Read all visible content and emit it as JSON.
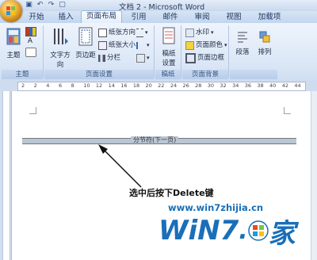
{
  "window": {
    "title": "文档 2 - Microsoft Word"
  },
  "quick_access": [
    {
      "icon": "save-icon",
      "glyph": "▣"
    },
    {
      "icon": "undo-icon",
      "glyph": "↶"
    },
    {
      "icon": "redo-icon",
      "glyph": "↷"
    },
    {
      "icon": "open-icon",
      "glyph": "▢"
    }
  ],
  "tabs": [
    {
      "label": "开始",
      "active": false
    },
    {
      "label": "插入",
      "active": false
    },
    {
      "label": "页面布局",
      "active": true
    },
    {
      "label": "引用",
      "active": false
    },
    {
      "label": "邮件",
      "active": false
    },
    {
      "label": "审阅",
      "active": false
    },
    {
      "label": "视图",
      "active": false
    },
    {
      "label": "加载项",
      "active": false
    }
  ],
  "ribbon": {
    "groups": [
      {
        "label": "主题"
      },
      {
        "label": "页面设置"
      },
      {
        "label": "稿纸"
      },
      {
        "label": "页面背景"
      },
      {
        "label": ""
      }
    ],
    "theme": {
      "themes_label": "主题"
    },
    "page_setup": {
      "text_direction": "文字方向",
      "margins": "页边距",
      "orientation": "纸张方向",
      "size": "纸张大小",
      "columns": "分栏"
    },
    "manuscript": {
      "settings_label": "稿纸\n设置",
      "line1": "稿纸",
      "line2": "设置"
    },
    "page_background": {
      "watermark": "水印",
      "page_color": "页面颜色",
      "page_border": "页面边框"
    },
    "paragraph": {
      "label": "段落"
    },
    "arrange": {
      "label": "排列"
    }
  },
  "ruler": {
    "numbers": [
      "2",
      "2",
      "4",
      "6",
      "8",
      "10",
      "12",
      "14",
      "16",
      "18",
      "20",
      "22",
      "24",
      "26",
      "28",
      "30",
      "32",
      "34",
      "36",
      "38",
      "40",
      "42",
      "44"
    ]
  },
  "document": {
    "section_break_label": "分节符(下一页)",
    "instruction": "选中后按下Delete键"
  },
  "watermark": {
    "url": "www.win7zhijia.cn",
    "brand": "WiN7",
    "suffix": "家"
  },
  "colors": {
    "ribbon_top": "#eef4fc",
    "ribbon_bottom": "#cfdff2",
    "accent": "#1a6fb8",
    "section_break": "#b9c6d4"
  }
}
